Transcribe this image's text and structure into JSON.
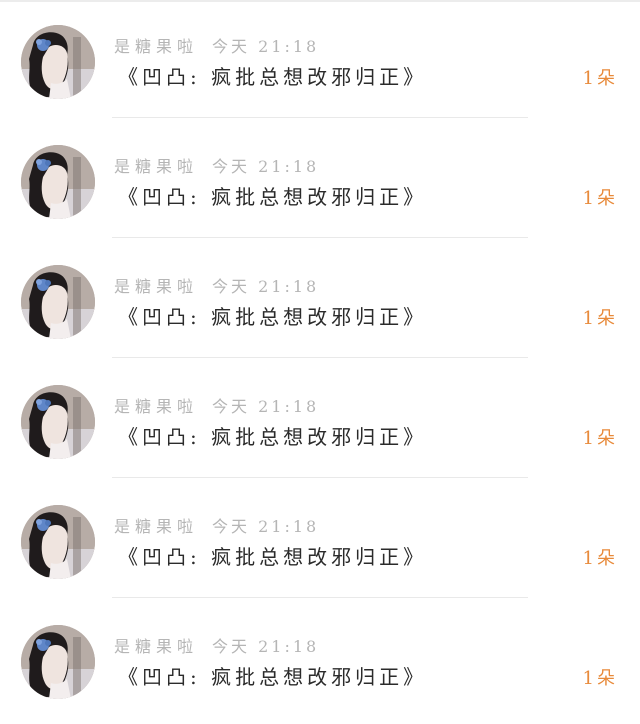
{
  "comments": [
    {
      "username": "是糖果啦",
      "time": "今天 21:18",
      "text": "《凹凸: 疯批总想改邪归正》",
      "count": "1朵"
    },
    {
      "username": "是糖果啦",
      "time": "今天 21:18",
      "text": "《凹凸: 疯批总想改邪归正》",
      "count": "1朵"
    },
    {
      "username": "是糖果啦",
      "time": "今天 21:18",
      "text": "《凹凸: 疯批总想改邪归正》",
      "count": "1朵"
    },
    {
      "username": "是糖果啦",
      "time": "今天 21:18",
      "text": "《凹凸: 疯批总想改邪归正》",
      "count": "1朵"
    },
    {
      "username": "是糖果啦",
      "time": "今天 21:18",
      "text": "《凹凸: 疯批总想改邪归正》",
      "count": "1朵"
    },
    {
      "username": "是糖果啦",
      "time": "今天 21:18",
      "text": "《凹凸: 疯批总想改邪归正》",
      "count": "1朵"
    }
  ],
  "colors": {
    "username": "#b5b5b5",
    "text": "#2b2b2b",
    "count": "#e88a3a"
  },
  "icons": {
    "avatar": "avatar-photo"
  }
}
